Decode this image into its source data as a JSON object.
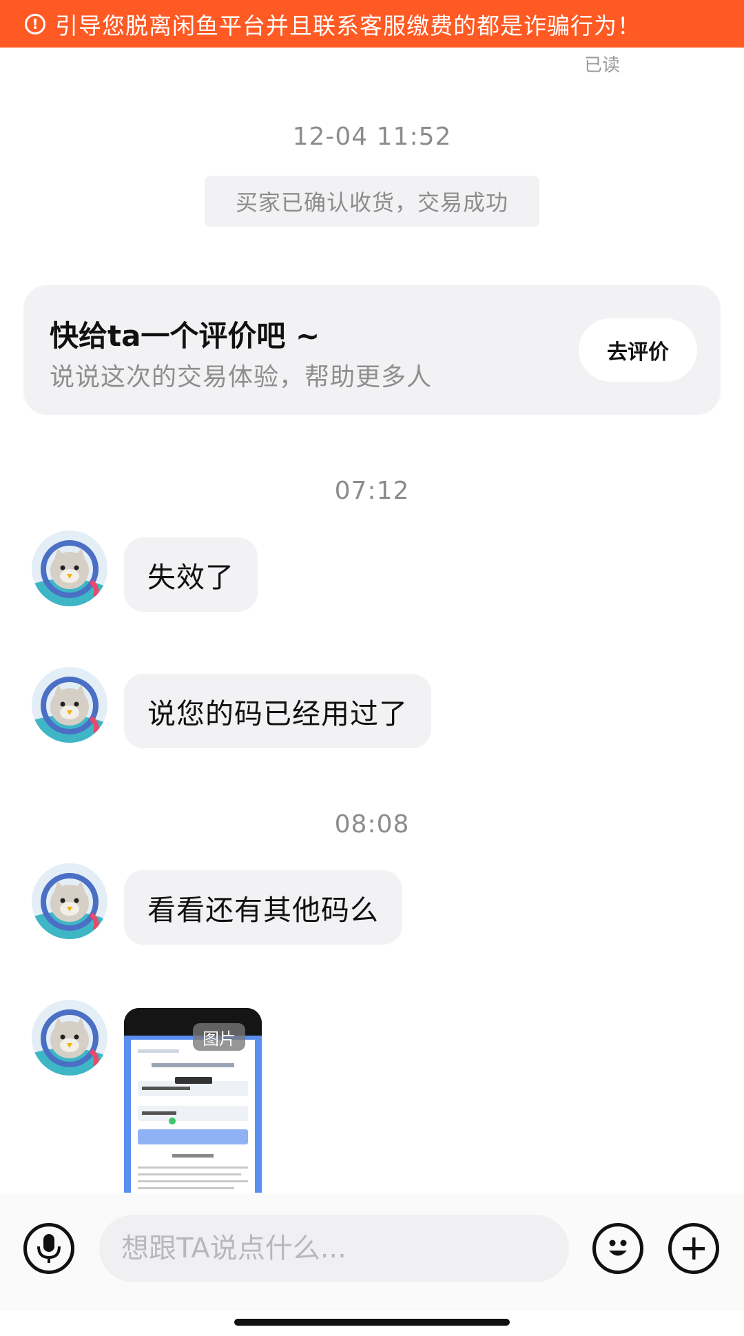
{
  "banner": {
    "icon": "alert-circle-icon",
    "text": "引导您脱离闲鱼平台并且联系客服缴费的都是诈骗行为！",
    "color": "#ff5a24"
  },
  "read_status": "已读",
  "timestamps": [
    "12-04 11:52",
    "07:12",
    "08:08"
  ],
  "system_notice": "买家已确认收货，交易成功",
  "review_card": {
    "title": "快给ta一个评价吧 ~",
    "subtitle": "说说这次的交易体验，帮助更多人",
    "button_label": "去评价"
  },
  "messages": [
    {
      "type": "text",
      "text": "失效了"
    },
    {
      "type": "text",
      "text": "说您的码已经用过了"
    },
    {
      "type": "text",
      "text": "看看还有其他码么"
    },
    {
      "type": "image",
      "label": "图片"
    }
  ],
  "input_bar": {
    "placeholder": "想跟TA说点什么...",
    "voice_icon": "microphone-icon",
    "emoji_icon": "emoji-icon",
    "add_icon": "plus-icon"
  }
}
